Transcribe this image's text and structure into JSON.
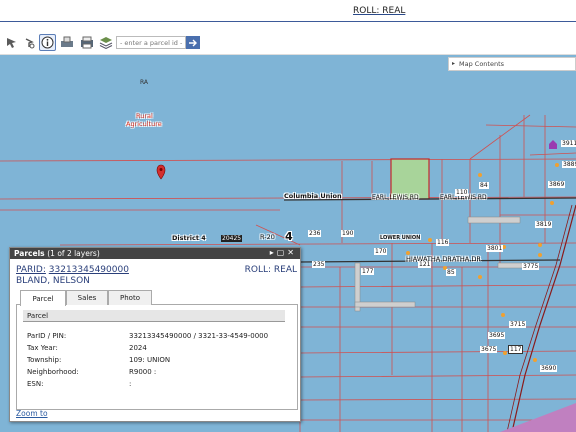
{
  "header": {
    "roll": "ROLL: REAL"
  },
  "toolbar": {
    "search_placeholder": "- enter a parcel id -"
  },
  "map_contents": {
    "label": "Map Contents"
  },
  "map": {
    "labels": {
      "ra": "RA",
      "rural": "Rural",
      "agriculture": "Agriculture",
      "columbia_union": "Columbia Union",
      "earl_lewis_1": "EARL LEWIS RD",
      "earl_lewis_2": "EARL LEWIS RD",
      "district": "District 4",
      "r20": "R-20",
      "four": "4",
      "lower_union": "LOWER UNION",
      "hiawatha": "HIAWATHA DR",
      "hiawatha2": "ATHA DR"
    },
    "numbers": [
      "236",
      "190",
      "235",
      "177",
      "170",
      "116",
      "121",
      "85",
      "3801",
      "3775",
      "3715",
      "3695",
      "3675",
      "3690",
      "3819",
      "3869",
      "3889",
      "3911",
      "84",
      "110",
      "117",
      "20425",
      "177"
    ],
    "colors": {
      "water": "#7fb4d6",
      "parcel_line": "#d05050",
      "selected_fill": "#a8d49a",
      "accent": "#4a6fae"
    }
  },
  "popup": {
    "title": "Parcels",
    "subtitle": "(1 of 2 layers)",
    "parid_label": "PARID:",
    "parid_value": "33213345490000",
    "roll": "ROLL: REAL",
    "owner": "BLAND, NELSON",
    "tabs": [
      "Parcel",
      "Sales",
      "Photo"
    ],
    "section": "Parcel",
    "rows": [
      {
        "label": "ParID / PIN:",
        "value": "33213345490000 / 3321-33-4549-0000"
      },
      {
        "label": "Tax Year:",
        "value": "2024"
      },
      {
        "label": "Township:",
        "value": "109: UNION"
      },
      {
        "label": "Neighborhood:",
        "value": "R9000 :"
      },
      {
        "label": "ESN:",
        "value": ":"
      }
    ],
    "zoom_to": "Zoom to"
  }
}
